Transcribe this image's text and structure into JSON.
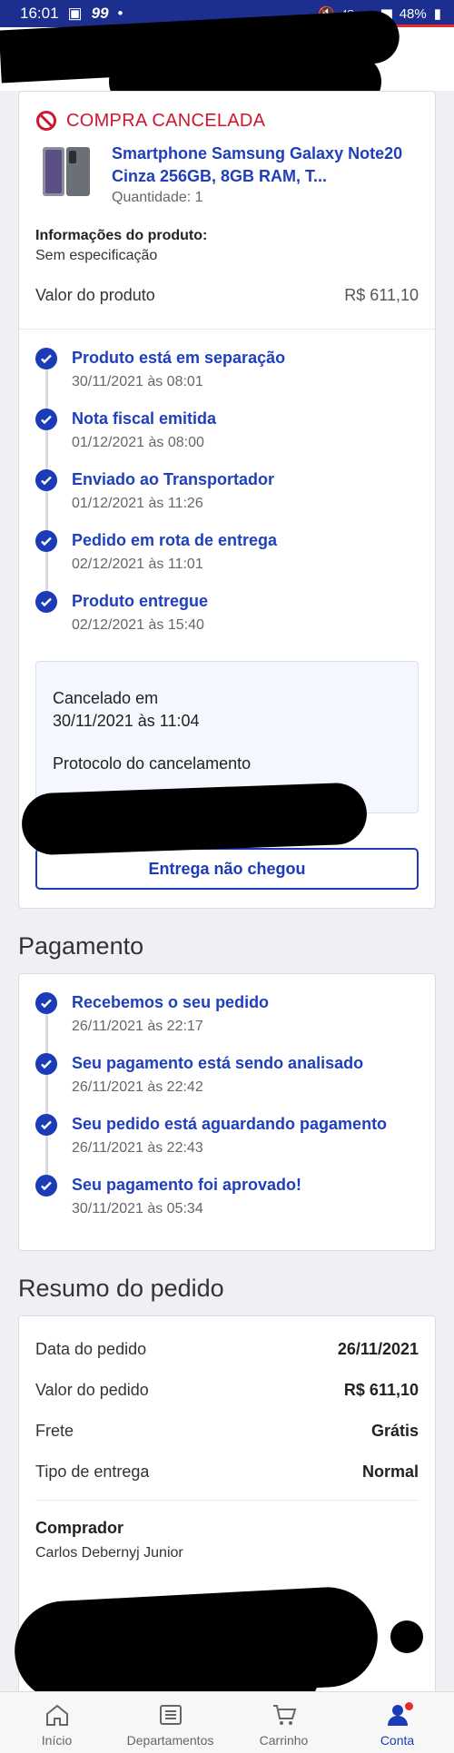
{
  "status_bar": {
    "time": "16:01",
    "carrier_mark": "99",
    "network": "4G",
    "battery": "48%"
  },
  "order_card": {
    "status_label": "COMPRA CANCELADA",
    "product": {
      "title": "Smartphone Samsung Galaxy Note20 Cinza 256GB, 8GB RAM, T...",
      "quantity": "Quantidade: 1"
    },
    "info_label": "Informações do produto:",
    "info_value": "Sem especificação",
    "value_label": "Valor do produto",
    "value_amount": "R$ 611,10",
    "timeline": [
      {
        "title": "Produto está em separação",
        "date": "30/11/2021 às 08:01"
      },
      {
        "title": "Nota fiscal emitida",
        "date": "01/12/2021 às 08:00"
      },
      {
        "title": "Enviado ao Transportador",
        "date": "01/12/2021 às 11:26"
      },
      {
        "title": "Pedido em rota de entrega",
        "date": "02/12/2021 às 11:01"
      },
      {
        "title": "Produto entregue",
        "date": "02/12/2021 às 15:40"
      }
    ],
    "cancel_box": {
      "label": "Cancelado em",
      "date": "30/11/2021 às 11:04",
      "protocol_label": "Protocolo do cancelamento"
    },
    "button_label": "Entrega não chegou"
  },
  "payment": {
    "title": "Pagamento",
    "timeline": [
      {
        "title": "Recebemos o seu pedido",
        "date": "26/11/2021 às 22:17"
      },
      {
        "title": "Seu pagamento está sendo analisado",
        "date": "26/11/2021 às 22:42"
      },
      {
        "title": "Seu pedido está aguardando pagamento",
        "date": "26/11/2021 às 22:43"
      },
      {
        "title": "Seu pagamento foi aprovado!",
        "date": "30/11/2021 às 05:34"
      }
    ]
  },
  "summary": {
    "title": "Resumo do pedido",
    "rows": [
      {
        "label": "Data do pedido",
        "value": "26/11/2021"
      },
      {
        "label": "Valor do pedido",
        "value": "R$ 611,10"
      },
      {
        "label": "Frete",
        "value": "Grátis"
      },
      {
        "label": "Tipo de entrega",
        "value": "Normal"
      }
    ],
    "buyer_label": "Comprador",
    "buyer_name": "Carlos Debernyj Junior"
  },
  "nav": {
    "items": [
      {
        "label": "Início",
        "icon": "home-icon"
      },
      {
        "label": "Departamentos",
        "icon": "list-icon"
      },
      {
        "label": "Carrinho",
        "icon": "cart-icon"
      },
      {
        "label": "Conta",
        "icon": "user-icon"
      }
    ]
  },
  "colors": {
    "accent": "#1b3bb7",
    "cancel_red": "#d01730",
    "status_bar": "#1c2f8f"
  }
}
